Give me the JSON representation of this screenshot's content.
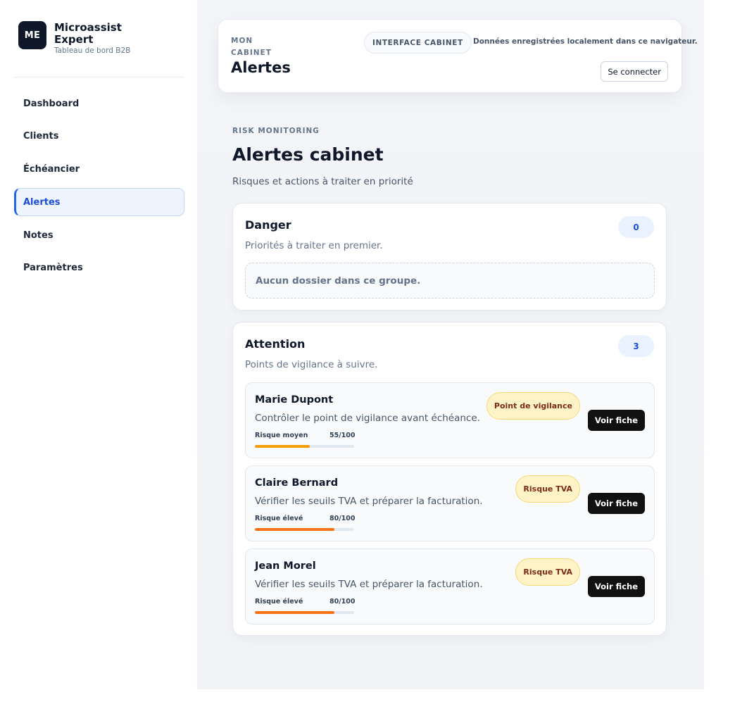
{
  "sidebar": {
    "logo_initials": "ME",
    "brand_name": "Microassist Expert",
    "brand_sub": "Tableau de bord B2B",
    "items": [
      {
        "label": "Dashboard",
        "active": false
      },
      {
        "label": "Clients",
        "active": false
      },
      {
        "label": "Échéancier",
        "active": false
      },
      {
        "label": "Alertes",
        "active": true
      },
      {
        "label": "Notes",
        "active": false
      },
      {
        "label": "Paramètres",
        "active": false
      }
    ]
  },
  "header": {
    "breadcrumb": "MON CABINET",
    "title": "Alertes",
    "badge": "INTERFACE CABINET",
    "storage_note": "Données enregistrées localement dans ce navigateur.",
    "login_label": "Se connecter"
  },
  "section": {
    "eyebrow": "RISK MONITORING",
    "title": "Alertes cabinet",
    "subtitle": "Risques et actions à traiter en priorité"
  },
  "groups": {
    "danger": {
      "title": "Danger",
      "description": "Priorités à traiter en premier.",
      "count": "0",
      "empty_text": "Aucun dossier dans ce groupe."
    },
    "attention": {
      "title": "Attention",
      "description": "Points de vigilance à suivre.",
      "count": "3",
      "items": [
        {
          "name": "Marie Dupont",
          "description": "Contrôler le point de vigilance avant échéance.",
          "risk_label": "Risque moyen",
          "score_text": "55/100",
          "score": 55,
          "bar_color": "#f59e0b",
          "tag": "Point de vigilance",
          "action": "Voir fiche"
        },
        {
          "name": "Claire Bernard",
          "description": "Vérifier les seuils TVA et préparer la facturation.",
          "risk_label": "Risque élevé",
          "score_text": "80/100",
          "score": 80,
          "bar_color": "#f97316",
          "tag": "Risque TVA",
          "action": "Voir fiche"
        },
        {
          "name": "Jean Morel",
          "description": "Vérifier les seuils TVA et préparer la facturation.",
          "risk_label": "Risque élevé",
          "score_text": "80/100",
          "score": 80,
          "bar_color": "#f97316",
          "tag": "Risque TVA",
          "action": "Voir fiche"
        }
      ]
    }
  }
}
